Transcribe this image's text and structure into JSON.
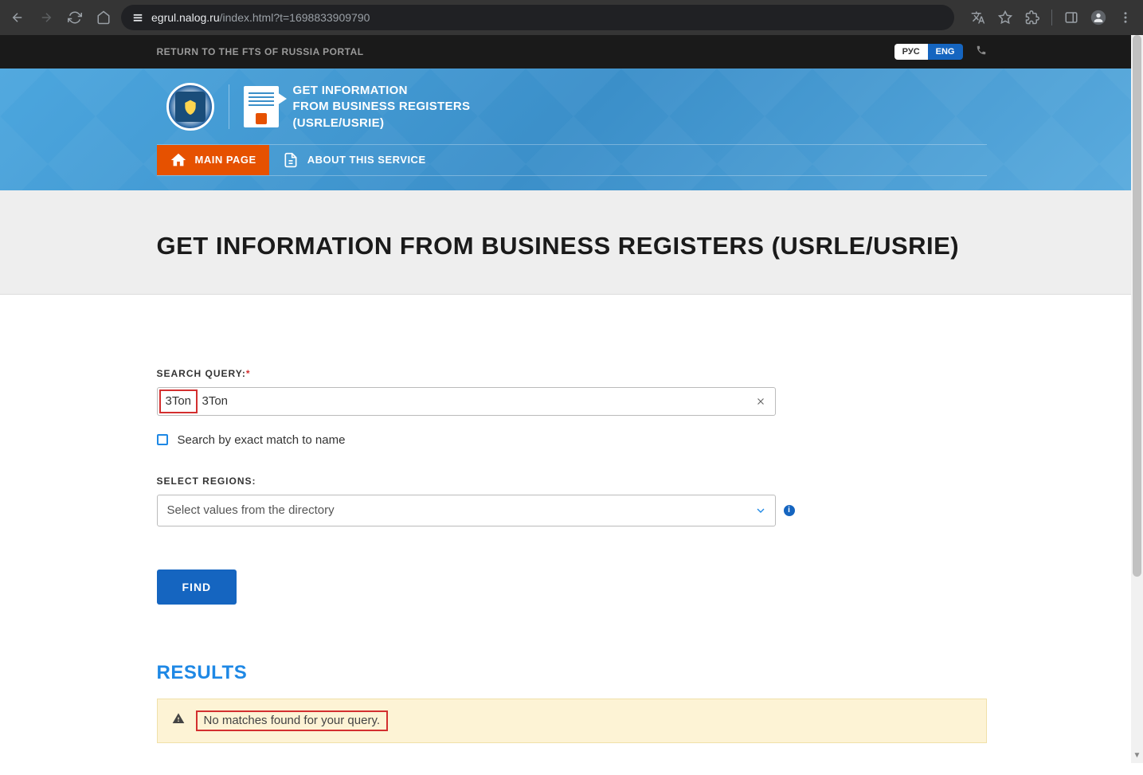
{
  "browser": {
    "url_domain": "egrul.nalog.ru",
    "url_path": "/index.html?t=1698833909790"
  },
  "topbar": {
    "return_link": "RETURN TO THE FTS OF RUSSIA PORTAL",
    "lang_rus": "РУС",
    "lang_eng": "ENG"
  },
  "header": {
    "title_line1": "GET INFORMATION",
    "title_line2": "FROM BUSINESS REGISTERS",
    "title_line3": "(USRLE/USRIE)"
  },
  "nav": {
    "main_page": "MAIN PAGE",
    "about": "ABOUT THIS SERVICE"
  },
  "page": {
    "title": "GET INFORMATION FROM BUSINESS REGISTERS (USRLE/USRIE)"
  },
  "form": {
    "search_label": "SEARCH QUERY:",
    "search_value": "3Ton",
    "exact_match_label": "Search by exact match to name",
    "regions_label": "SELECT REGIONS:",
    "regions_placeholder": "Select values from the directory",
    "find_button": "FIND"
  },
  "results": {
    "title": "RESULTS",
    "no_matches": "No matches found for your query."
  }
}
